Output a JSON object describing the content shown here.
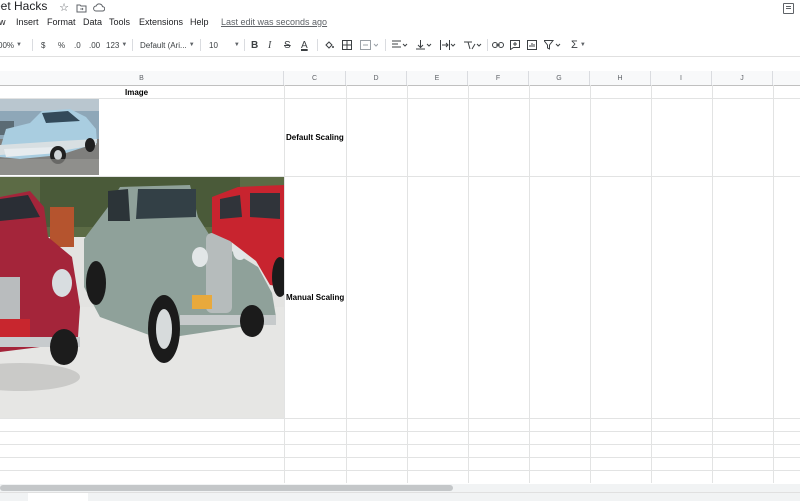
{
  "title_bar": {
    "doc_title": "eet Hacks",
    "icons": [
      "star-icon",
      "folder-move-icon",
      "cloud-status-icon"
    ]
  },
  "menu": {
    "items": [
      "w",
      "Insert",
      "Format",
      "Data",
      "Tools",
      "Extensions",
      "Help"
    ],
    "last_edit": "Last edit was seconds ago"
  },
  "toolbar": {
    "zoom": "00%",
    "currency": "$",
    "percent": "%",
    "decrease_decimal": ".0",
    "increase_decimal": ".00",
    "number_format": "123",
    "font": "Default (Ari...",
    "font_size": "10",
    "bold": "B",
    "italic": "I",
    "strike": "S",
    "text_color": "A",
    "sum": "Σ"
  },
  "grid": {
    "columns": [
      "B",
      "C",
      "D",
      "E",
      "F",
      "G",
      "H",
      "I",
      "J"
    ],
    "cells": {
      "header_image": "Image",
      "default_scaling": "Default Scaling",
      "manual_scaling": "Manual Scaling"
    }
  },
  "colors": {
    "accent": "#1a73e8",
    "grid_line": "#e2e3e3",
    "header_bg": "#f8f9fa"
  }
}
